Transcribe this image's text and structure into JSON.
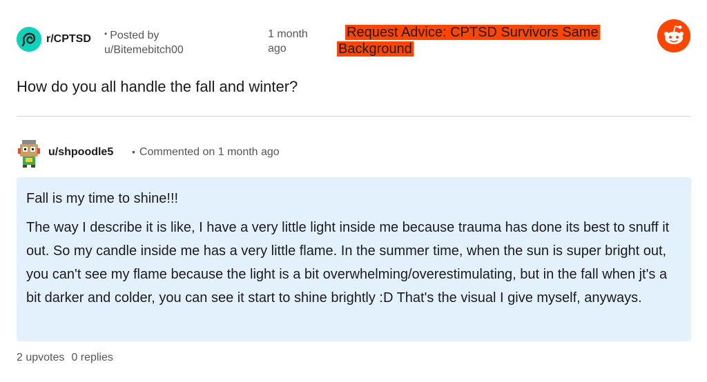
{
  "post": {
    "subreddit": "r/CPTSD",
    "posted_by_label": "Posted by",
    "author": "u/Bitemebitch00",
    "time_line1": "1 month",
    "time_line2": "ago",
    "flair": "Request Advice: CPTSD Survivors Same Background",
    "title": "How do you all handle the fall and winter?"
  },
  "comment": {
    "author": "u/shpoodle5",
    "meta": "Commented on 1 month ago",
    "paragraph1": "Fall is my time to shine!!!",
    "paragraph2": "The way I describe it is like, I have a very little light inside me because trauma has done its best to snuff it out. So my candle inside me has a very little flame. In the summer time, when the sun is super bright out, you can't see my flame because the light is a bit overwhelming/overestimulating, but in the fall when jt's a bit darker and colder, you can see it start to shine brightly :D That's the visual I give myself, anyways.",
    "upvotes": "2 upvotes",
    "replies": "0 replies"
  },
  "icons": {
    "subreddit": "subreddit-community-icon",
    "logo": "reddit-snoo-logo",
    "avatar": "user-avatar-icon"
  },
  "colors": {
    "flair_bg": "#ff4500",
    "reddit_orange": "#ff4500",
    "comment_bg": "#e3f1fd",
    "subreddit_icon": "#0dd3bb"
  }
}
